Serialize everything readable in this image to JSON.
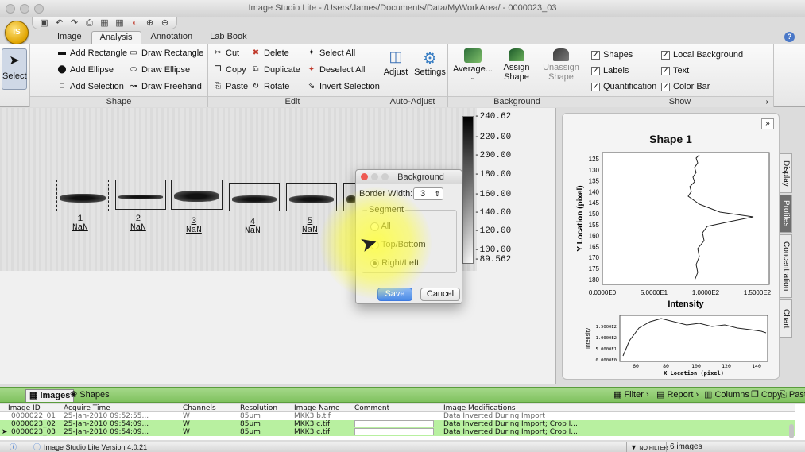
{
  "window": {
    "title": "Image Studio Lite - /Users/James/Documents/Data/MyWorkArea/ - 0000023_03"
  },
  "menu": {
    "tabs": [
      "Image",
      "Analysis",
      "Annotation",
      "Lab Book"
    ],
    "active": "Analysis"
  },
  "ribbon": {
    "select_label": "Select",
    "shape": {
      "title": "Shape",
      "items": [
        "Add Rectangle",
        "Draw Rectangle",
        "Add Ellipse",
        "Draw Ellipse",
        "Add Selection",
        "Draw Freehand"
      ]
    },
    "edit": {
      "title": "Edit",
      "items": [
        "Cut",
        "Delete",
        "Select All",
        "Copy",
        "Duplicate",
        "Deselect All",
        "Paste",
        "Rotate",
        "Invert Selection"
      ]
    },
    "auto_adjust": {
      "title": "Auto-Adjust",
      "adjust": "Adjust",
      "settings": "Settings"
    },
    "background": {
      "title": "Background",
      "average": "Average...",
      "assign": "Assign",
      "assign2": "Shape",
      "unassign": "Unassign",
      "unassign2": "Shape"
    },
    "show": {
      "title": "Show",
      "items": [
        "Shapes",
        "Local Background",
        "Labels",
        "Text",
        "Quantification",
        "Color Bar"
      ]
    }
  },
  "blot": {
    "lane_labels": [
      {
        "num": "1",
        "val": "NaN"
      },
      {
        "num": "2",
        "val": "NaN"
      },
      {
        "num": "3",
        "val": "NaN"
      },
      {
        "num": "4",
        "val": "NaN"
      },
      {
        "num": "5",
        "val": "NaN"
      }
    ]
  },
  "colorbar": {
    "ticks": [
      "-240.62",
      "-220.00",
      "-200.00",
      "-180.00",
      "-160.00",
      "-140.00",
      "-120.00",
      "-100.00",
      "-89.562"
    ]
  },
  "dialog": {
    "title": "Background",
    "border_width_label": "Border Width:",
    "border_width_value": "3",
    "segment_label": "Segment",
    "options": [
      "All",
      "Top/Bottom",
      "Right/Left"
    ],
    "selected": "Right/Left",
    "save": "Save",
    "cancel": "Cancel"
  },
  "profile": {
    "expand": "»",
    "title": "Shape 1",
    "ylabel": "Y Location (pixel)",
    "xlabel": "Intensity",
    "yticks": [
      "125",
      "130",
      "135",
      "140",
      "145",
      "150",
      "155",
      "160",
      "165",
      "170",
      "175",
      "180"
    ],
    "xticks": [
      "0.0000E0",
      "5.0000E1",
      "1.0000E2",
      "1.5000E2"
    ],
    "mini_ylabel": "Intensity",
    "mini_yticks": [
      "1.5000E2",
      "1.0000E2",
      "5.0000E1",
      "0.0000E0"
    ],
    "mini_xticks": [
      "60",
      "80",
      "100",
      "120",
      "140"
    ],
    "mini_xlabel": "X Location (pixel)"
  },
  "side_tabs": [
    "Display",
    "Profiles",
    "Concentration",
    "Chart"
  ],
  "side_tab_active": "Profiles",
  "bottom": {
    "tabs": [
      "Images",
      "Shapes"
    ],
    "buttons": [
      "Filter",
      "Report",
      "Columns",
      "Copy",
      "Paste"
    ],
    "columns": [
      "Image ID",
      "Acquire Time",
      "Channels",
      "Resolution",
      "Image Name",
      "Comment",
      "Image Modifications"
    ],
    "rows": [
      [
        "0000022_01",
        "25-Jan-2010 09:52:55...",
        "W",
        "85um",
        "MKK3 b.tif",
        "",
        "Data Inverted During Import"
      ],
      [
        "0000023_02",
        "25-Jan-2010 09:54:09...",
        "W",
        "85um",
        "MKK3 c.tif",
        "",
        "Data Inverted During Import; Crop I..."
      ],
      [
        "0000023_03",
        "25-Jan-2010 09:54:09...",
        "W",
        "85um",
        "MKK3 c.tif",
        "",
        "Data Inverted During Import; Crop I..."
      ]
    ]
  },
  "status": {
    "version": "Image Studio Lite Version 4.0.21",
    "filter": "NO FILTER",
    "count": "6 images"
  },
  "colors": {
    "accent_green": "#7fc15e",
    "row_highlight": "#b8f0a0"
  }
}
